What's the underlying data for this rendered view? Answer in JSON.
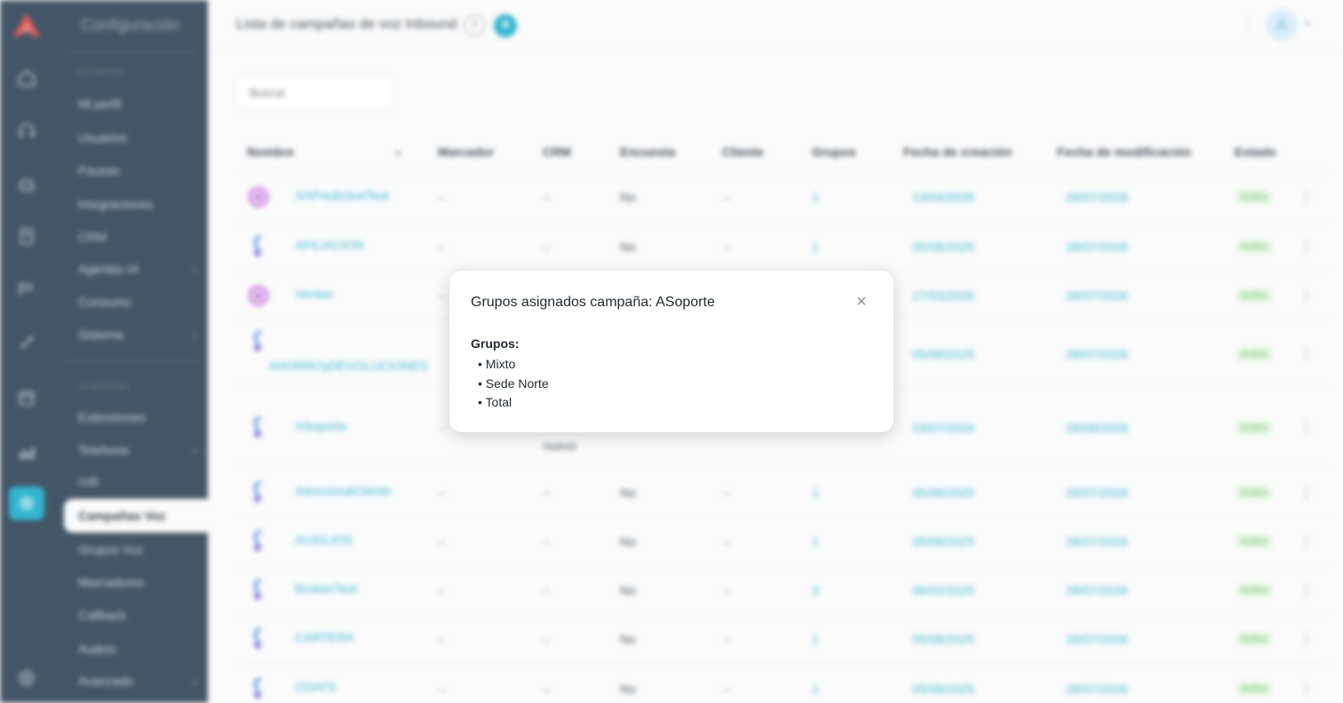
{
  "rail": {
    "icons": [
      "home-icon",
      "headset-icon",
      "robot-icon",
      "contacts-icon",
      "routes-icon",
      "rocket-icon",
      "calendar-icon",
      "chart-icon",
      "settings-icon",
      "help-circle-icon"
    ]
  },
  "sidebar": {
    "title": "Configuración",
    "section_general": "GENERAL",
    "section_llamadas": "LLAMADAS",
    "general_items": [
      "Mi perfil",
      "Usuarios",
      "Pausas",
      "Integraciones",
      "CRM",
      "Agentes IA",
      "Consumo",
      "Sistema"
    ],
    "llamadas_items": [
      "Extensiones",
      "Telefonía",
      "IVR",
      "Campañas Voz",
      "Grupos Voz",
      "Marcadores",
      "Callback",
      "Audios",
      "Avanzado"
    ],
    "active_item": "Campañas Voz"
  },
  "header": {
    "title": "Lista de campañas de voz Inbound",
    "help_label": "?",
    "add_label": "+",
    "more_label": "⋮",
    "avatar_initial": "A"
  },
  "search": {
    "placeholder": "Buscar"
  },
  "table": {
    "columns": [
      "Nombre",
      "Marcador",
      "CRM",
      "Encuesta",
      "Cliente",
      "Grupos",
      "Fecha de creación",
      "Fecha de modificación",
      "Estado"
    ],
    "rows": [
      {
        "icon": "ai",
        "nombre": "AAPredictiveTest",
        "marcador": "--",
        "crm": "--",
        "encuesta": "No",
        "cliente": "--",
        "grupos": "1",
        "creacion": "13/04/2026",
        "modificacion": "28/07/2026",
        "estado": "Activo"
      },
      {
        "icon": "inbound",
        "nombre": "AFILIACION",
        "marcador": "--",
        "crm": "--",
        "encuesta": "No",
        "cliente": "--",
        "grupos": "1",
        "creacion": "05/08/2025",
        "modificacion": "28/07/2026",
        "estado": "Activo"
      },
      {
        "icon": "ai",
        "nombre": "Ventas",
        "marcador": "--",
        "crm": "",
        "encuesta": "",
        "cliente": "",
        "grupos": "",
        "creacion": "27/03/2026",
        "modificacion": "28/07/2026",
        "estado": "Activo"
      },
      {
        "icon": "inbound",
        "nombre": "AHORROyDEVOLUCIONES",
        "marcador": "",
        "crm": "",
        "encuesta": "",
        "cliente": "",
        "grupos": "",
        "creacion": "05/08/2025",
        "modificacion": "28/07/2026",
        "estado": "Activo"
      },
      {
        "icon": "inbound",
        "nombre": "ASoporte",
        "marcador": "--",
        "crm": "nuevo",
        "encuesta": "",
        "cliente": "",
        "grupos": "",
        "creacion": "03/07/2024",
        "modificacion": "28/08/2026",
        "estado": "Activo"
      },
      {
        "icon": "inbound",
        "nombre": "AtencionalCliente",
        "marcador": "--",
        "crm": "--",
        "encuesta": "No",
        "cliente": "--",
        "grupos": "1",
        "creacion": "05/08/2025",
        "modificacion": "28/07/2026",
        "estado": "Activo"
      },
      {
        "icon": "inbound",
        "nombre": "AUXILIOS",
        "marcador": "--",
        "crm": "--",
        "encuesta": "No",
        "cliente": "--",
        "grupos": "1",
        "creacion": "05/08/2025",
        "modificacion": "28/07/2026",
        "estado": "Activo"
      },
      {
        "icon": "inbound",
        "nombre": "BrokenTest",
        "marcador": "--",
        "crm": "--",
        "encuesta": "No",
        "cliente": "--",
        "grupos": "3",
        "creacion": "06/02/2025",
        "modificacion": "28/07/2026",
        "estado": "Activo"
      },
      {
        "icon": "inbound",
        "nombre": "CARTERA",
        "marcador": "--",
        "crm": "--",
        "encuesta": "No",
        "cliente": "--",
        "grupos": "1",
        "creacion": "05/08/2025",
        "modificacion": "28/07/2026",
        "estado": "Activo"
      },
      {
        "icon": "inbound",
        "nombre": "CDATS",
        "marcador": "--",
        "crm": "--",
        "encuesta": "No",
        "cliente": "--",
        "grupos": "1",
        "creacion": "05/08/2025",
        "modificacion": "28/07/2026",
        "estado": "Activo"
      }
    ]
  },
  "modal": {
    "title": "Grupos asignados campaña: ASoporte",
    "close_label": "×",
    "groups_label": "Grupos:",
    "groups": [
      "Mixto",
      "Sede Norte",
      "Total"
    ]
  },
  "colors": {
    "sidebar_bg": "#3d4f61",
    "accent": "#2bb3cf",
    "link": "#35b7d3",
    "status_active": "#5fbf59"
  }
}
